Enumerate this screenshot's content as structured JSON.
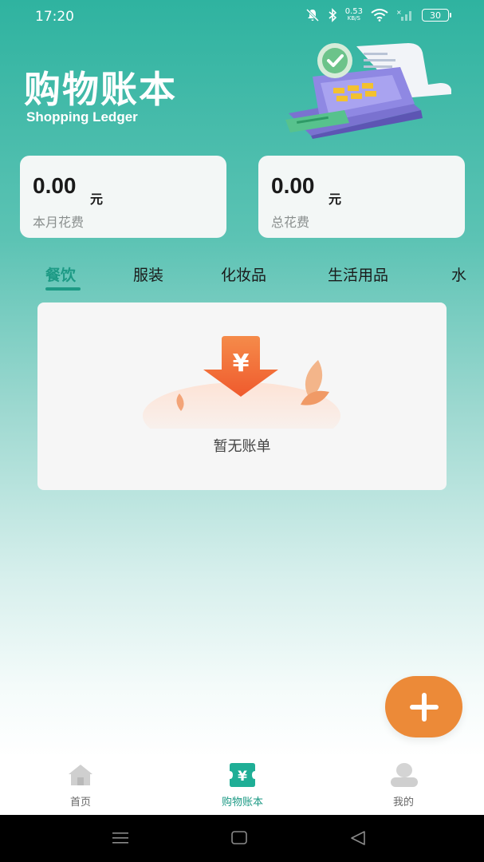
{
  "status_bar": {
    "time": "17:20",
    "net_speed": "0.53",
    "net_unit": "KB/S",
    "battery": "30",
    "icons": [
      "mute-icon",
      "bluetooth-icon",
      "wifi-icon",
      "signal-icon",
      "battery-icon"
    ]
  },
  "header": {
    "title": "购物账本",
    "subtitle": "Shopping Ledger"
  },
  "summary": {
    "month": {
      "amount": "0.00",
      "unit": "元",
      "label": "本月花费"
    },
    "total": {
      "amount": "0.00",
      "unit": "元",
      "label": "总花费"
    }
  },
  "tabs": [
    {
      "label": "餐饮",
      "active": true
    },
    {
      "label": "服装",
      "active": false
    },
    {
      "label": "化妆品",
      "active": false
    },
    {
      "label": "生活用品",
      "active": false
    },
    {
      "label": "水",
      "active": false
    }
  ],
  "empty_state": {
    "text": "暂无账单",
    "icon_text": "¥"
  },
  "fab": {
    "icon": "plus-icon"
  },
  "bottom_nav": [
    {
      "label": "首页",
      "icon": "home-icon",
      "active": false
    },
    {
      "label": "购物账本",
      "icon": "yen-ticket-icon",
      "active": true
    },
    {
      "label": "我的",
      "icon": "user-icon",
      "active": false
    }
  ],
  "colors": {
    "primary": "#1d9a85",
    "header_gradient_top": "#2fb3a0",
    "fab": "#ec8a38",
    "empty_arrow": "#f26a3c"
  }
}
